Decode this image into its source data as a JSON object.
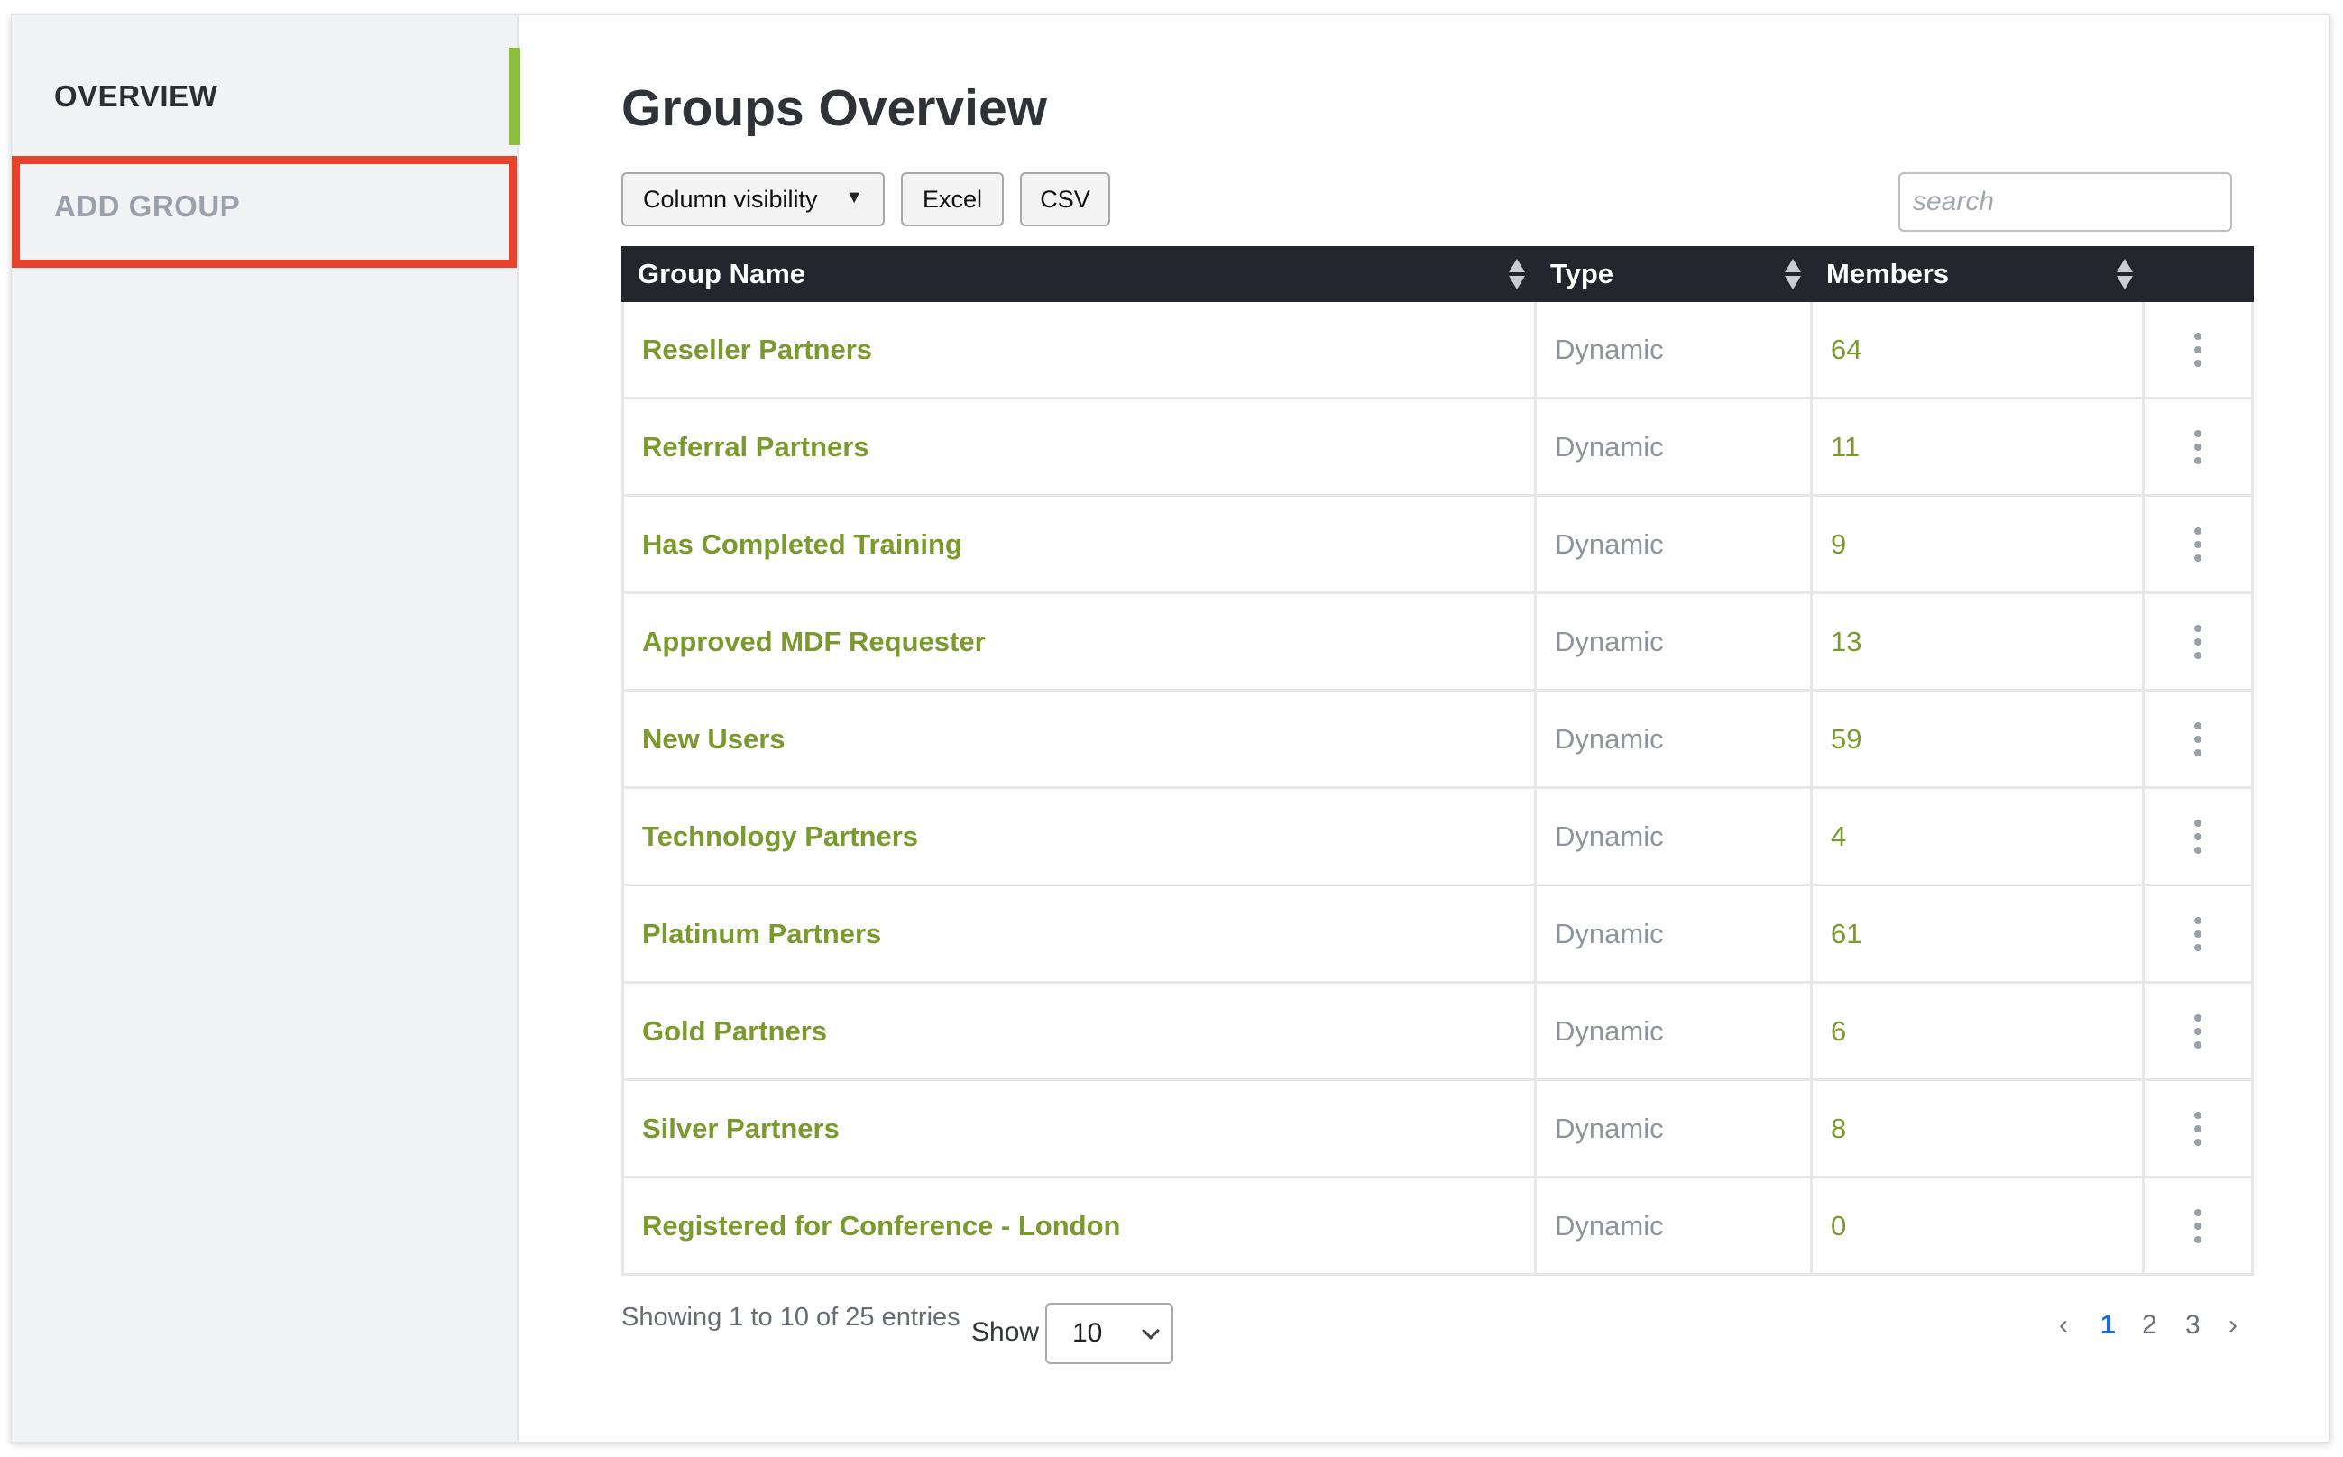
{
  "sidebar": {
    "items": [
      {
        "label": "OVERVIEW"
      },
      {
        "label": "ADD GROUP"
      }
    ]
  },
  "main": {
    "title": "Groups Overview",
    "toolbar": {
      "column_visibility": "Column visibility",
      "excel": "Excel",
      "csv": "CSV",
      "search_placeholder": "search"
    },
    "table": {
      "columns": [
        "Group Name",
        "Type",
        "Members"
      ],
      "rows": [
        {
          "name": "Reseller Partners",
          "type": "Dynamic",
          "members": "64"
        },
        {
          "name": "Referral Partners",
          "type": "Dynamic",
          "members": "11"
        },
        {
          "name": "Has Completed Training",
          "type": "Dynamic",
          "members": "9"
        },
        {
          "name": "Approved MDF Requester",
          "type": "Dynamic",
          "members": "13"
        },
        {
          "name": "New Users",
          "type": "Dynamic",
          "members": "59"
        },
        {
          "name": "Technology Partners",
          "type": "Dynamic",
          "members": "4"
        },
        {
          "name": "Platinum Partners",
          "type": "Dynamic",
          "members": "61"
        },
        {
          "name": "Gold Partners",
          "type": "Dynamic",
          "members": "6"
        },
        {
          "name": "Silver Partners",
          "type": "Dynamic",
          "members": "8"
        },
        {
          "name": "Registered for Conference - London",
          "type": "Dynamic",
          "members": "0"
        }
      ]
    },
    "footer": {
      "info": "Showing 1 to 10 of 25 entries",
      "show_label": "Show",
      "page_size": "10",
      "pages": [
        "1",
        "2",
        "3"
      ],
      "prev": "‹",
      "next": "›"
    }
  },
  "colors": {
    "accent_green": "#8cbd3f",
    "link_green": "#7a9a2e",
    "header_dark": "#23272d",
    "highlight_red": "#e8412c",
    "active_page_blue": "#1f6bd6"
  }
}
